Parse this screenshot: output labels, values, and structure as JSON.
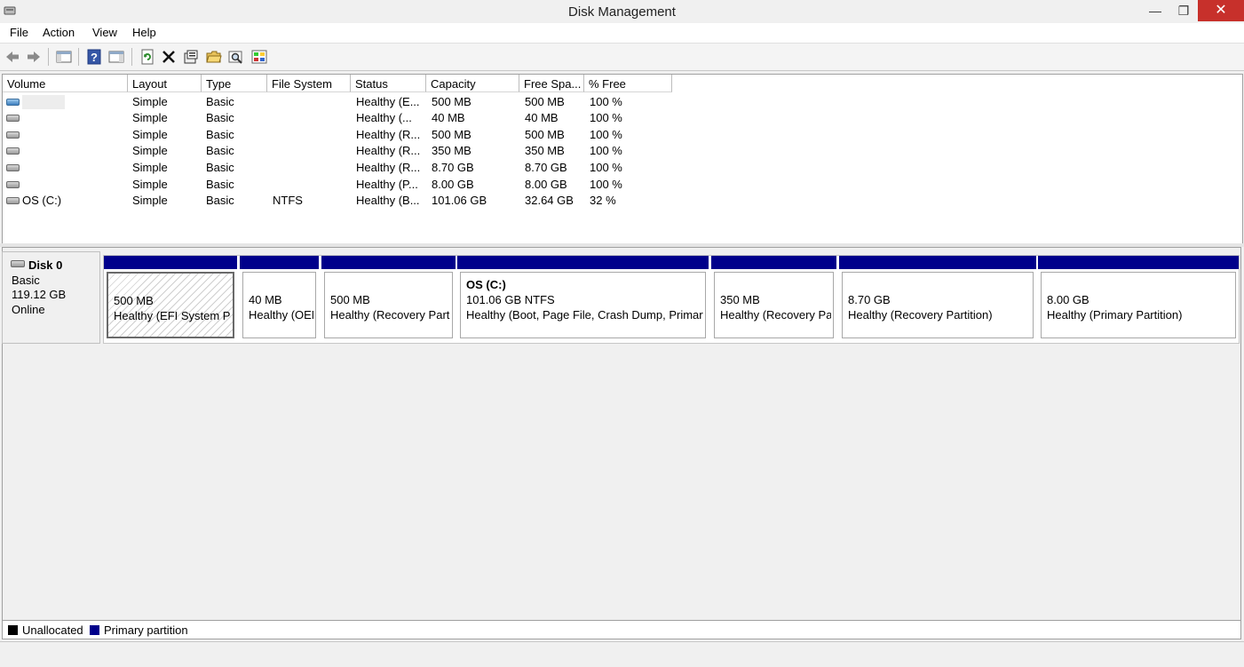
{
  "window": {
    "title": "Disk Management"
  },
  "menu": {
    "items": [
      "File",
      "Action",
      "View",
      "Help"
    ]
  },
  "toolbar": {
    "icons": [
      "back-arrow-icon",
      "forward-arrow-icon",
      "console-tree-icon",
      "help-icon",
      "properties-view-icon",
      "refresh-icon",
      "delete-icon",
      "properties-icon",
      "open-folder-icon",
      "search-icon",
      "rescan-icon"
    ]
  },
  "colors": {
    "primary_partition": "#00008b",
    "unallocated": "#000000",
    "close_button": "#c7302b"
  },
  "volume_list": {
    "columns": [
      "Volume",
      "Layout",
      "Type",
      "File System",
      "Status",
      "Capacity",
      "Free Spa...",
      "% Free"
    ],
    "rows": [
      {
        "volume": "",
        "layout": "Simple",
        "type": "Basic",
        "fs": "",
        "status": "Healthy (E...",
        "capacity": "500 MB",
        "free": "500 MB",
        "pct": "100 %",
        "icon": "blue-disk-icon"
      },
      {
        "volume": "",
        "layout": "Simple",
        "type": "Basic",
        "fs": "",
        "status": "Healthy (...",
        "capacity": "40 MB",
        "free": "40 MB",
        "pct": "100 %",
        "icon": "disk-icon"
      },
      {
        "volume": "",
        "layout": "Simple",
        "type": "Basic",
        "fs": "",
        "status": "Healthy (R...",
        "capacity": "500 MB",
        "free": "500 MB",
        "pct": "100 %",
        "icon": "disk-icon"
      },
      {
        "volume": "",
        "layout": "Simple",
        "type": "Basic",
        "fs": "",
        "status": "Healthy (R...",
        "capacity": "350 MB",
        "free": "350 MB",
        "pct": "100 %",
        "icon": "disk-icon"
      },
      {
        "volume": "",
        "layout": "Simple",
        "type": "Basic",
        "fs": "",
        "status": "Healthy (R...",
        "capacity": "8.70 GB",
        "free": "8.70 GB",
        "pct": "100 %",
        "icon": "disk-icon"
      },
      {
        "volume": "",
        "layout": "Simple",
        "type": "Basic",
        "fs": "",
        "status": "Healthy (P...",
        "capacity": "8.00 GB",
        "free": "8.00 GB",
        "pct": "100 %",
        "icon": "disk-icon"
      },
      {
        "volume": "OS (C:)",
        "layout": "Simple",
        "type": "Basic",
        "fs": "NTFS",
        "status": "Healthy (B...",
        "capacity": "101.06 GB",
        "free": "32.64 GB",
        "pct": "32 %",
        "icon": "disk-icon"
      }
    ]
  },
  "disk": {
    "name": "Disk 0",
    "type": "Basic",
    "size": "119.12 GB",
    "state": "Online",
    "partitions": [
      {
        "title": "",
        "size": "500 MB",
        "status": "Healthy (EFI System Par"
      },
      {
        "title": "",
        "size": "40 MB",
        "status": "Healthy (OEM"
      },
      {
        "title": "",
        "size": "500 MB",
        "status": "Healthy (Recovery Partit"
      },
      {
        "title": "OS  (C:)",
        "size": "101.06 GB NTFS",
        "status": "Healthy (Boot, Page File, Crash Dump, Primary"
      },
      {
        "title": "",
        "size": "350 MB",
        "status": "Healthy (Recovery Par"
      },
      {
        "title": "",
        "size": "8.70 GB",
        "status": "Healthy (Recovery Partition)"
      },
      {
        "title": "",
        "size": "8.00 GB",
        "status": "Healthy (Primary Partition)"
      }
    ]
  },
  "legend": {
    "unallocated": "Unallocated",
    "primary": "Primary partition"
  }
}
